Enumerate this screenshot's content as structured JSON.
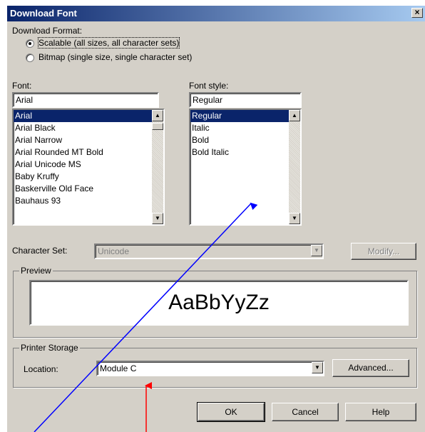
{
  "dialog": {
    "title": "Download Font",
    "close": "×"
  },
  "format": {
    "label": "Download Format:",
    "scalable_label": "Scalable (all sizes, all character sets)",
    "bitmap_label": "Bitmap (single size, single character set)"
  },
  "font": {
    "label": "Font:",
    "value": "Arial",
    "items": [
      "Arial",
      "Arial Black",
      "Arial Narrow",
      "Arial Rounded MT Bold",
      "Arial Unicode MS",
      "Baby Kruffy",
      "Baskerville Old Face",
      "Bauhaus 93"
    ],
    "selected": "Arial"
  },
  "style": {
    "label": "Font style:",
    "value": "Regular",
    "items": [
      "Regular",
      "Italic",
      "Bold",
      "Bold Italic"
    ],
    "selected": "Regular"
  },
  "charset": {
    "label": "Character Set:",
    "value": "Unicode",
    "modify_label": "Modify..."
  },
  "preview": {
    "label": "Preview",
    "text": "AaBbYyZz"
  },
  "storage": {
    "label": "Printer Storage",
    "location_label": "Location:",
    "location_value": "Module C",
    "advanced_label": "Advanced..."
  },
  "buttons": {
    "ok": "OK",
    "cancel": "Cancel",
    "help": "Help"
  },
  "arrows": {
    "down": "▼",
    "up": "▲"
  }
}
